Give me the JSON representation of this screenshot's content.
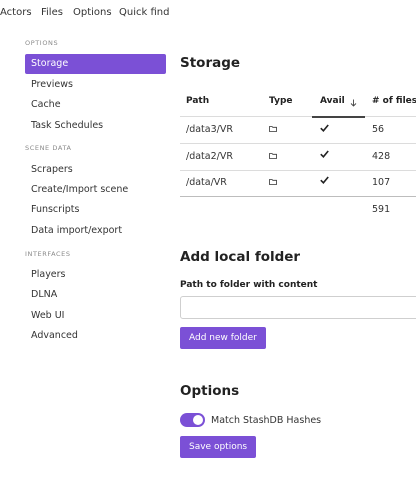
{
  "topnav": {
    "items": [
      {
        "label": "Actors"
      },
      {
        "label": "Files"
      },
      {
        "label": "Options"
      },
      {
        "label": "Quick find"
      }
    ]
  },
  "sidebar": {
    "sections": [
      {
        "title": "OPTIONS",
        "items": [
          "Storage",
          "Previews",
          "Cache",
          "Task Schedules"
        ]
      },
      {
        "title": "SCENE DATA",
        "items": [
          "Scrapers",
          "Create/Import scene",
          "Funscripts",
          "Data import/export"
        ]
      },
      {
        "title": "INTERFACES",
        "items": [
          "Players",
          "DLNA",
          "Web UI",
          "Advanced"
        ]
      }
    ],
    "active": "Storage"
  },
  "storage": {
    "title": "Storage",
    "columns": [
      "Path",
      "Type",
      "Avail",
      "# of files"
    ],
    "sort_column": "Avail",
    "sort_icon": "arrow-down-icon",
    "rows": [
      {
        "path": "/data3/VR",
        "type_icon": "folder-icon",
        "avail_icon": "check-icon",
        "files": "56"
      },
      {
        "path": "/data2/VR",
        "type_icon": "folder-icon",
        "avail_icon": "check-icon",
        "files": "428"
      },
      {
        "path": "/data/VR",
        "type_icon": "folder-icon",
        "avail_icon": "check-icon",
        "files": "107"
      }
    ],
    "total_files": "591"
  },
  "add_folder": {
    "title": "Add local folder",
    "path_label": "Path to folder with content",
    "path_value": "",
    "button_label": "Add new folder"
  },
  "options": {
    "title": "Options",
    "toggle_label": "Match StashDB Hashes",
    "toggle_on": true,
    "save_label": "Save options"
  },
  "colors": {
    "accent": "#7b50d6",
    "text": "#333333",
    "muted": "#8a8a8a"
  }
}
